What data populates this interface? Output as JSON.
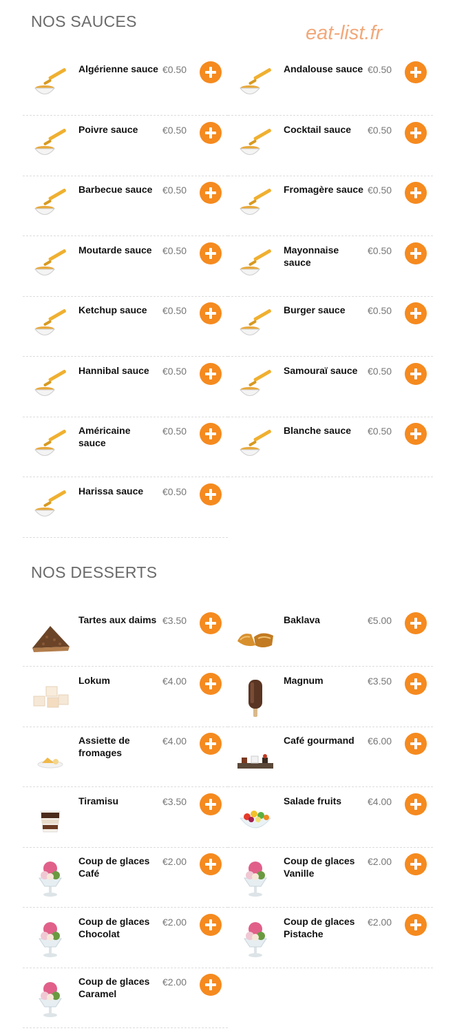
{
  "watermark": "eat-list.fr",
  "accent_color": "#f58a1f",
  "sauces": {
    "title": "NOS SAUCES",
    "items": [
      {
        "name": "Algérienne sauce",
        "price": "€0.50",
        "icon": "sauce-icon"
      },
      {
        "name": "Andalouse sauce",
        "price": "€0.50",
        "icon": "sauce-icon"
      },
      {
        "name": "Poivre sauce",
        "price": "€0.50",
        "icon": "sauce-icon"
      },
      {
        "name": "Cocktail sauce",
        "price": "€0.50",
        "icon": "sauce-icon"
      },
      {
        "name": "Barbecue sauce",
        "price": "€0.50",
        "icon": "sauce-icon"
      },
      {
        "name": "Fromagère sauce",
        "price": "€0.50",
        "icon": "sauce-icon"
      },
      {
        "name": "Moutarde sauce",
        "price": "€0.50",
        "icon": "sauce-icon"
      },
      {
        "name": "Mayonnaise sauce",
        "price": "€0.50",
        "icon": "sauce-icon"
      },
      {
        "name": "Ketchup sauce",
        "price": "€0.50",
        "icon": "sauce-icon"
      },
      {
        "name": "Burger sauce",
        "price": "€0.50",
        "icon": "sauce-icon"
      },
      {
        "name": "Hannibal sauce",
        "price": "€0.50",
        "icon": "sauce-icon"
      },
      {
        "name": "Samouraï sauce",
        "price": "€0.50",
        "icon": "sauce-icon"
      },
      {
        "name": "Américaine sauce",
        "price": "€0.50",
        "icon": "sauce-icon"
      },
      {
        "name": "Blanche sauce",
        "price": "€0.50",
        "icon": "sauce-icon"
      },
      {
        "name": "Harissa sauce",
        "price": "€0.50",
        "icon": "sauce-icon"
      }
    ]
  },
  "desserts": {
    "title": "NOS DESSERTS",
    "items": [
      {
        "name": "Tartes aux daims",
        "price": "€3.50",
        "icon": "pie-icon"
      },
      {
        "name": "Baklava",
        "price": "€5.00",
        "icon": "baklava-icon"
      },
      {
        "name": "Lokum",
        "price": "€4.00",
        "icon": "lokum-icon"
      },
      {
        "name": "Magnum",
        "price": "€3.50",
        "icon": "ice-cream-bar-icon"
      },
      {
        "name": "Assiette de fromages",
        "price": "€4.00",
        "icon": "cheese-plate-icon"
      },
      {
        "name": "Café gourmand",
        "price": "€6.00",
        "icon": "cafe-gourmand-icon"
      },
      {
        "name": "Tiramisu",
        "price": "€3.50",
        "icon": "tiramisu-icon"
      },
      {
        "name": "Salade fruits",
        "price": "€4.00",
        "icon": "fruit-salad-icon"
      },
      {
        "name": "Coup de glaces Café",
        "price": "€2.00",
        "icon": "sundae-icon"
      },
      {
        "name": "Coup de glaces Vanille",
        "price": "€2.00",
        "icon": "sundae-icon"
      },
      {
        "name": "Coup de glaces Chocolat",
        "price": "€2.00",
        "icon": "sundae-icon"
      },
      {
        "name": "Coup de glaces Pistache",
        "price": "€2.00",
        "icon": "sundae-icon"
      },
      {
        "name": "Coup de glaces Caramel",
        "price": "€2.00",
        "icon": "sundae-icon"
      }
    ]
  }
}
